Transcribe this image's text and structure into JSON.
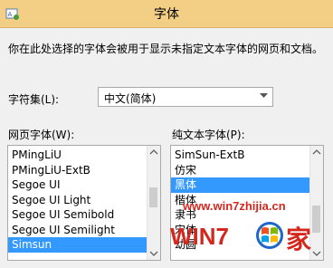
{
  "window": {
    "title": "字体"
  },
  "description": "你在此处选择的字体会被用于显示未指定文本字体的网页和文档。",
  "charset": {
    "label": "字符集(L):",
    "value": "中文(简体)"
  },
  "web_font": {
    "label": "网页字体(W):",
    "items": [
      "PMingLiU",
      "PMingLiU-ExtB",
      "Segoe UI",
      "Segoe UI Light",
      "Segoe UI Semibold",
      "Segoe UI Semilight",
      "Simsun"
    ],
    "selected": "Simsun"
  },
  "plain_font": {
    "label": "纯文本字体(P):",
    "items": [
      "SimSun-ExtB",
      "仿宋",
      "黑体",
      "楷体",
      "隶书",
      "宋体",
      "幼圆"
    ],
    "selected": "黑体"
  },
  "watermark": {
    "url": "www.win7zhijia.cn",
    "brand": "WIN7",
    "suffix": "家"
  },
  "colors": {
    "titlebar": "#f3cf86",
    "selection": "#3399ff",
    "watermark": "#d4281f"
  }
}
